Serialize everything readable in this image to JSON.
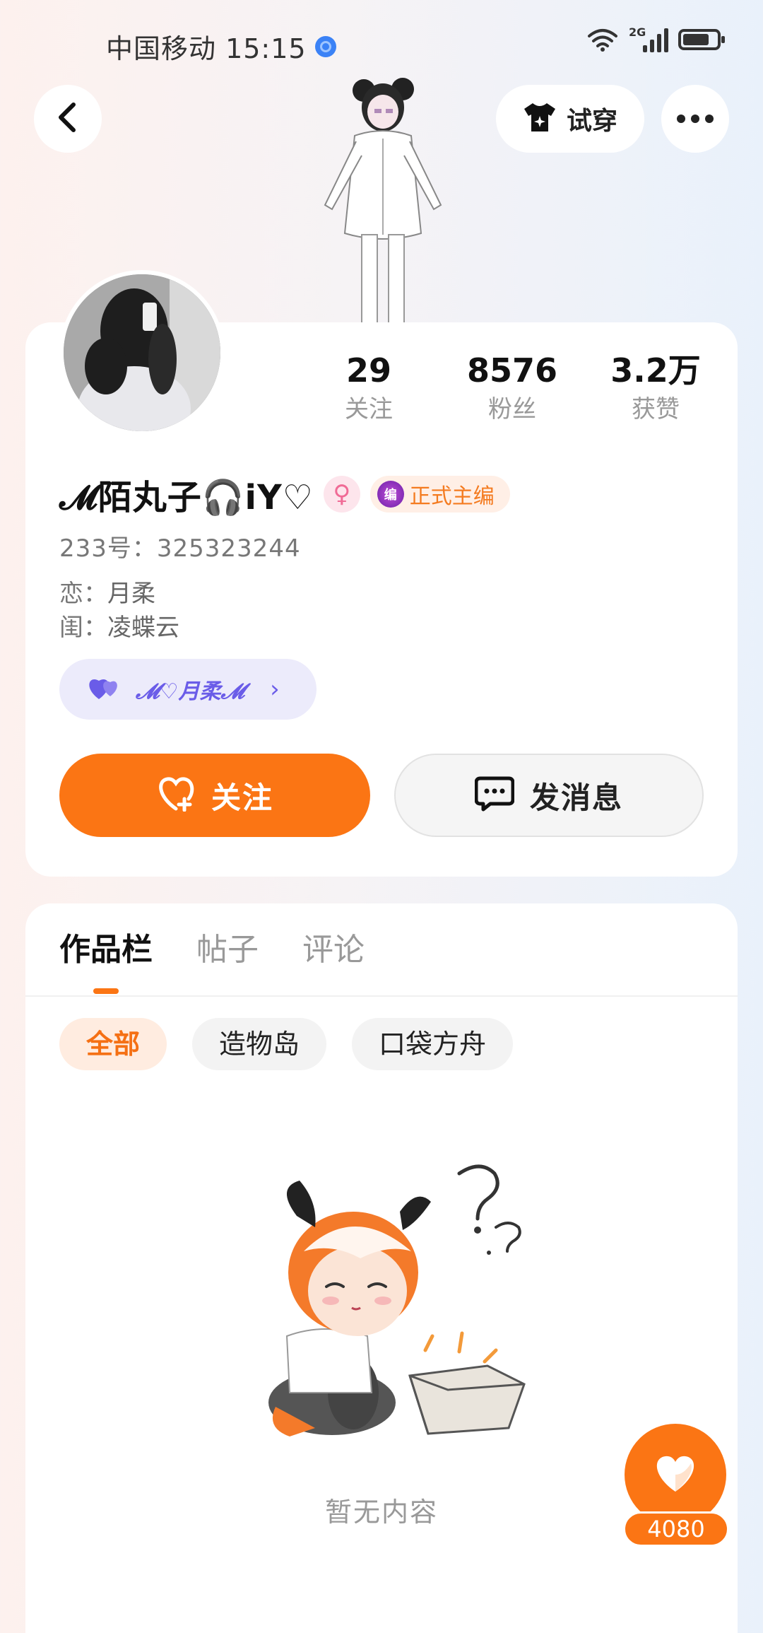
{
  "status_bar": {
    "carrier_time": "中国移动 15:15",
    "network": "2G"
  },
  "header": {
    "tryon_label": "试穿"
  },
  "profile": {
    "stats": [
      {
        "value": "29",
        "label": "关注"
      },
      {
        "value": "8576",
        "label": "粉丝"
      },
      {
        "value": "3.2万",
        "label": "获赞"
      }
    ],
    "username": "𝓜陌丸子🎧iY♡",
    "gender_symbol": "♀",
    "role_badge": {
      "icon_text": "编",
      "label": "正式主编"
    },
    "uid": "233号：325323244",
    "relations": [
      {
        "key": "恋：",
        "value": "月柔"
      },
      {
        "key": "闺：",
        "value": "凌蝶云"
      }
    ],
    "cp_chip": {
      "name": "𝓜♡月柔𝓜",
      "chevron": "›"
    },
    "follow_label": "关注",
    "message_label": "发消息"
  },
  "works": {
    "tabs": [
      {
        "label": "作品栏",
        "active": true
      },
      {
        "label": "帖子",
        "active": false
      },
      {
        "label": "评论",
        "active": false
      }
    ],
    "filters": [
      {
        "label": "全部",
        "active": true
      },
      {
        "label": "造物岛",
        "active": false
      },
      {
        "label": "口袋方舟",
        "active": false
      }
    ],
    "empty_text": "暂无内容"
  },
  "fab": {
    "count": "4080"
  },
  "colors": {
    "accent": "#fb7514",
    "cp_purple": "#6a5ce8",
    "female_pink": "#f06b96"
  }
}
